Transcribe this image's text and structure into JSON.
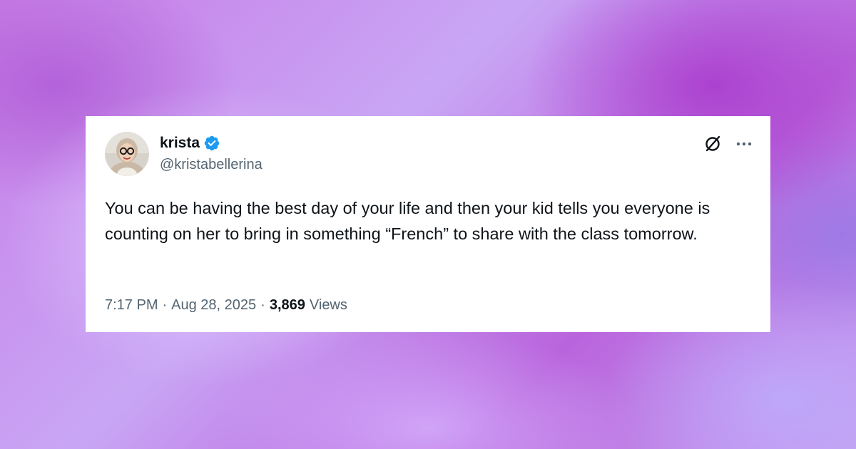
{
  "author": {
    "display_name": "krista",
    "handle": "@kristabellerina",
    "verified": true
  },
  "tweet": {
    "text": "You can be having the best day of your life and then your kid tells you everyone is counting on her to bring in something “French” to share with the class tomorrow.",
    "time": "7:17 PM",
    "date": "Aug 28, 2025",
    "separator": "·",
    "views_count": "3,869",
    "views_label": "Views"
  },
  "icons": {
    "verified": "verified-badge-icon",
    "grok": "grok-icon",
    "more": "more-options-icon"
  },
  "colors": {
    "text_primary": "#0f1419",
    "text_secondary": "#536471",
    "verified_blue": "#1d9bf0",
    "card_background": "#ffffff"
  }
}
